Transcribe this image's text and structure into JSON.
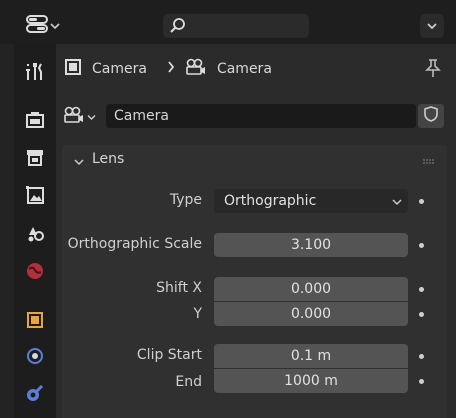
{
  "header": {
    "editor_icon": "properties-editor-icon",
    "search_icon": "search-icon"
  },
  "tabs": [
    "tool-tab-icon",
    "render-tab-icon",
    "output-tab-icon",
    "view-layer-tab-icon",
    "scene-tab-icon",
    "world-tab-icon",
    "object-tab-icon",
    "physics-tab-icon",
    "object-data-tab-icon"
  ],
  "breadcrumb": {
    "object": "Camera",
    "data": "Camera"
  },
  "datablock": {
    "name": "Camera"
  },
  "lens_panel": {
    "title": "Lens",
    "type_label": "Type",
    "type_value": "Orthographic",
    "ortho_scale_label": "Orthographic Scale",
    "ortho_scale_value": "3.100",
    "shift_x_label": "Shift X",
    "shift_x_value": "0.000",
    "shift_y_label": "Y",
    "shift_y_value": "0.000",
    "clip_start_label": "Clip Start",
    "clip_start_value": "0.1 m",
    "clip_end_label": "End",
    "clip_end_value": "1000 m"
  },
  "colors": {
    "background": "#232323",
    "panel": "#303030",
    "field": "#545454",
    "accent_orange": "#e8a63c",
    "accent_blue": "#5a7fd6",
    "accent_red": "#c0404a"
  }
}
